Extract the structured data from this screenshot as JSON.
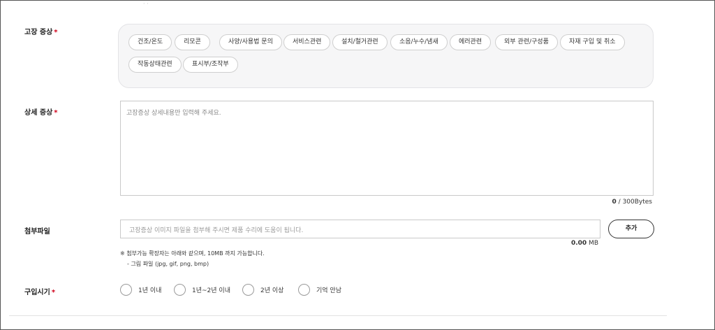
{
  "required_mark": "*",
  "top_fragment": "·   ·",
  "symptom": {
    "label": "고장 증상",
    "chips": [
      "건조/온도",
      "리모콘",
      "사양/사용법 문의",
      "서비스관련",
      "설치/철거관련",
      "소음/누수/냄새",
      "에러관련",
      "외부 관련/구성품",
      "자재 구입 및 취소",
      "작동상태관련",
      "표시부/조작부"
    ]
  },
  "detail": {
    "label": "상세 증상",
    "placeholder": "고장증상 상세내용만 입력해 주세요.",
    "count": "0",
    "limit": " / 300Bytes"
  },
  "attachment": {
    "label": "첨부파일",
    "placeholder": "고장증상 이미지 파일을 첨부해 주시면 제품 수리에 도움이 됩니다.",
    "add_button": "추가",
    "size_value": "0.00",
    "size_unit": " MB",
    "note_1": "※ 첨부가능 확장자는 아래와 같으며, 10MB 까지 가능합니다.",
    "note_2": "- 그림 파일 (jpg, gif, png, bmp)"
  },
  "purchase": {
    "label": "구입시기",
    "options": [
      "1년 이내",
      "1년~2년 이내",
      "2년 이상",
      "기억 안남"
    ]
  }
}
